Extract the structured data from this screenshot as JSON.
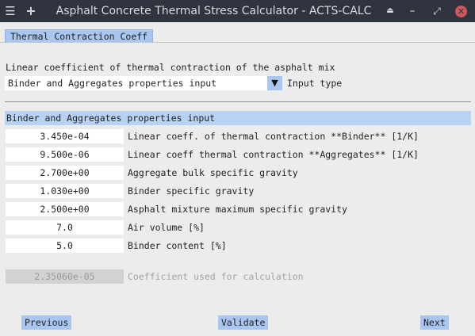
{
  "window": {
    "title": "Asphalt Concrete Thermal Stress Calculator - ACTS-CALC",
    "menu_glyph": "☰",
    "plus_glyph": "+",
    "up_glyph": "⏏",
    "minimize_glyph": "–",
    "restore_glyph": "⤢",
    "close_glyph": "✕"
  },
  "tab": {
    "label": "Thermal Contraction Coeff"
  },
  "mix_label": "Linear coefficient of thermal contraction of the asphalt mix",
  "input_type": {
    "selected": "Binder and Aggregates properties input",
    "arrow": "▼",
    "label": "Input type"
  },
  "section_title": "Binder and Aggregates properties input",
  "fields": [
    {
      "value": "3.450e-04",
      "label": "Linear coeff. of thermal contraction **Binder** [1/K]"
    },
    {
      "value": "9.500e-06",
      "label": "Linear coeff thermal contraction **Aggregates** [1/K]"
    },
    {
      "value": "2.700e+00",
      "label": "Aggregate bulk specific gravity"
    },
    {
      "value": "1.030e+00",
      "label": "Binder specific gravity"
    },
    {
      "value": "2.500e+00",
      "label": "Asphalt mixture maximum specific gravity"
    },
    {
      "value": "7.0",
      "label": "Air volume [%]"
    },
    {
      "value": "5.0",
      "label": "Binder content [%]"
    }
  ],
  "result": {
    "value": "2.35060e-05",
    "label": "Coefficient used for calculation"
  },
  "buttons": {
    "previous": "Previous",
    "validate": "Validate",
    "next": "Next"
  },
  "colors": {
    "titlebar": "#2f343f",
    "accent": "#a8c6ef",
    "section_header": "#b8d2f4",
    "close": "#cc575d",
    "background": "#ececec"
  }
}
